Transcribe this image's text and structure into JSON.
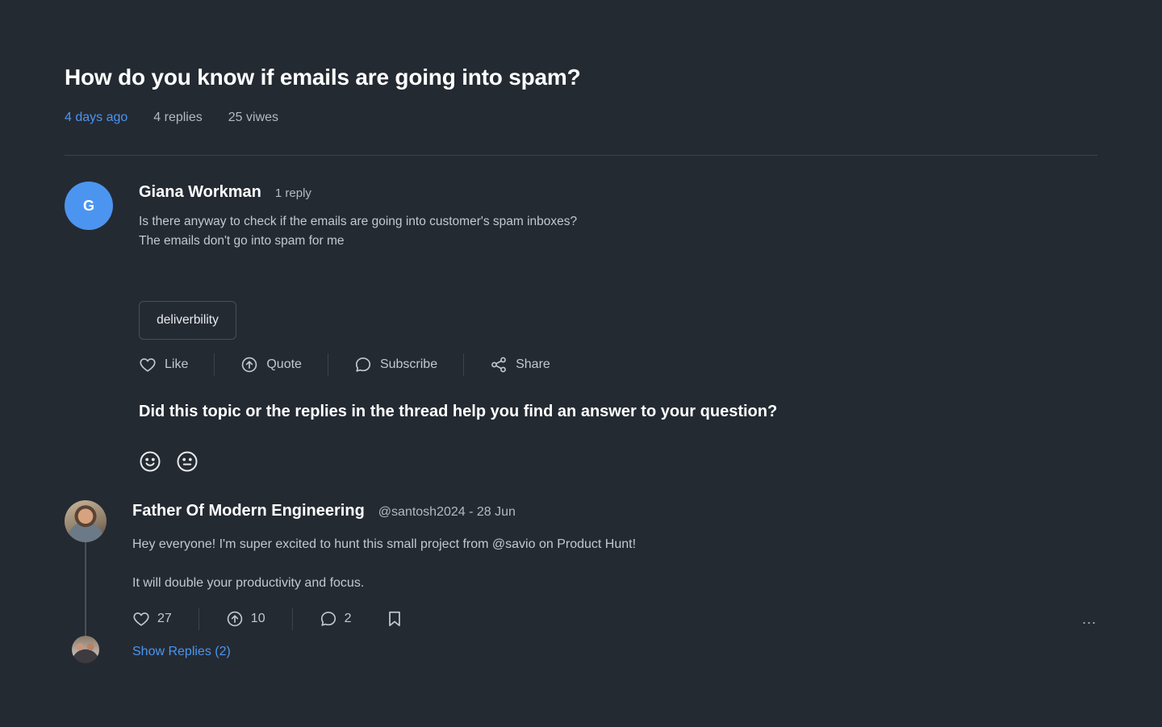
{
  "topic": {
    "title": "How do you know if emails are going into spam?",
    "posted": "4 days ago",
    "replies": "4 replies",
    "views": "25 viwes"
  },
  "post": {
    "avatar_initial": "G",
    "author": "Giana Workman",
    "reply_count": "1 reply",
    "body_line1": "Is there anyway to check if the emails are going into customer's spam inboxes?",
    "body_line2": "The emails don't go into spam for me",
    "tag": "deliverbility",
    "actions": {
      "like": "Like",
      "quote": "Quote",
      "subscribe": "Subscribe",
      "share": "Share"
    },
    "icons": [
      "heart-icon",
      "upvote-icon",
      "comment-icon",
      "share-icon"
    ]
  },
  "feedback": {
    "question": "Did this topic or the replies in the thread help you find an answer to your question?",
    "icons": [
      "smile-face-icon",
      "neutral-face-icon"
    ]
  },
  "reply": {
    "author": "Father Of Modern Engineering",
    "handle_date": "@santosh2024 - 28 Jun",
    "line1": "Hey everyone! I'm super excited to hunt this small project from @savio on Product Hunt!",
    "line2": "It will double your productivity and focus.",
    "likes": "27",
    "upvotes": "10",
    "comments": "2",
    "more": "...",
    "show_replies": "Show Replies (2)"
  },
  "colors": {
    "background": "#242a32",
    "accent": "#4b95f0",
    "text_primary": "#ffffff",
    "text_secondary": "#b4b9c0"
  }
}
